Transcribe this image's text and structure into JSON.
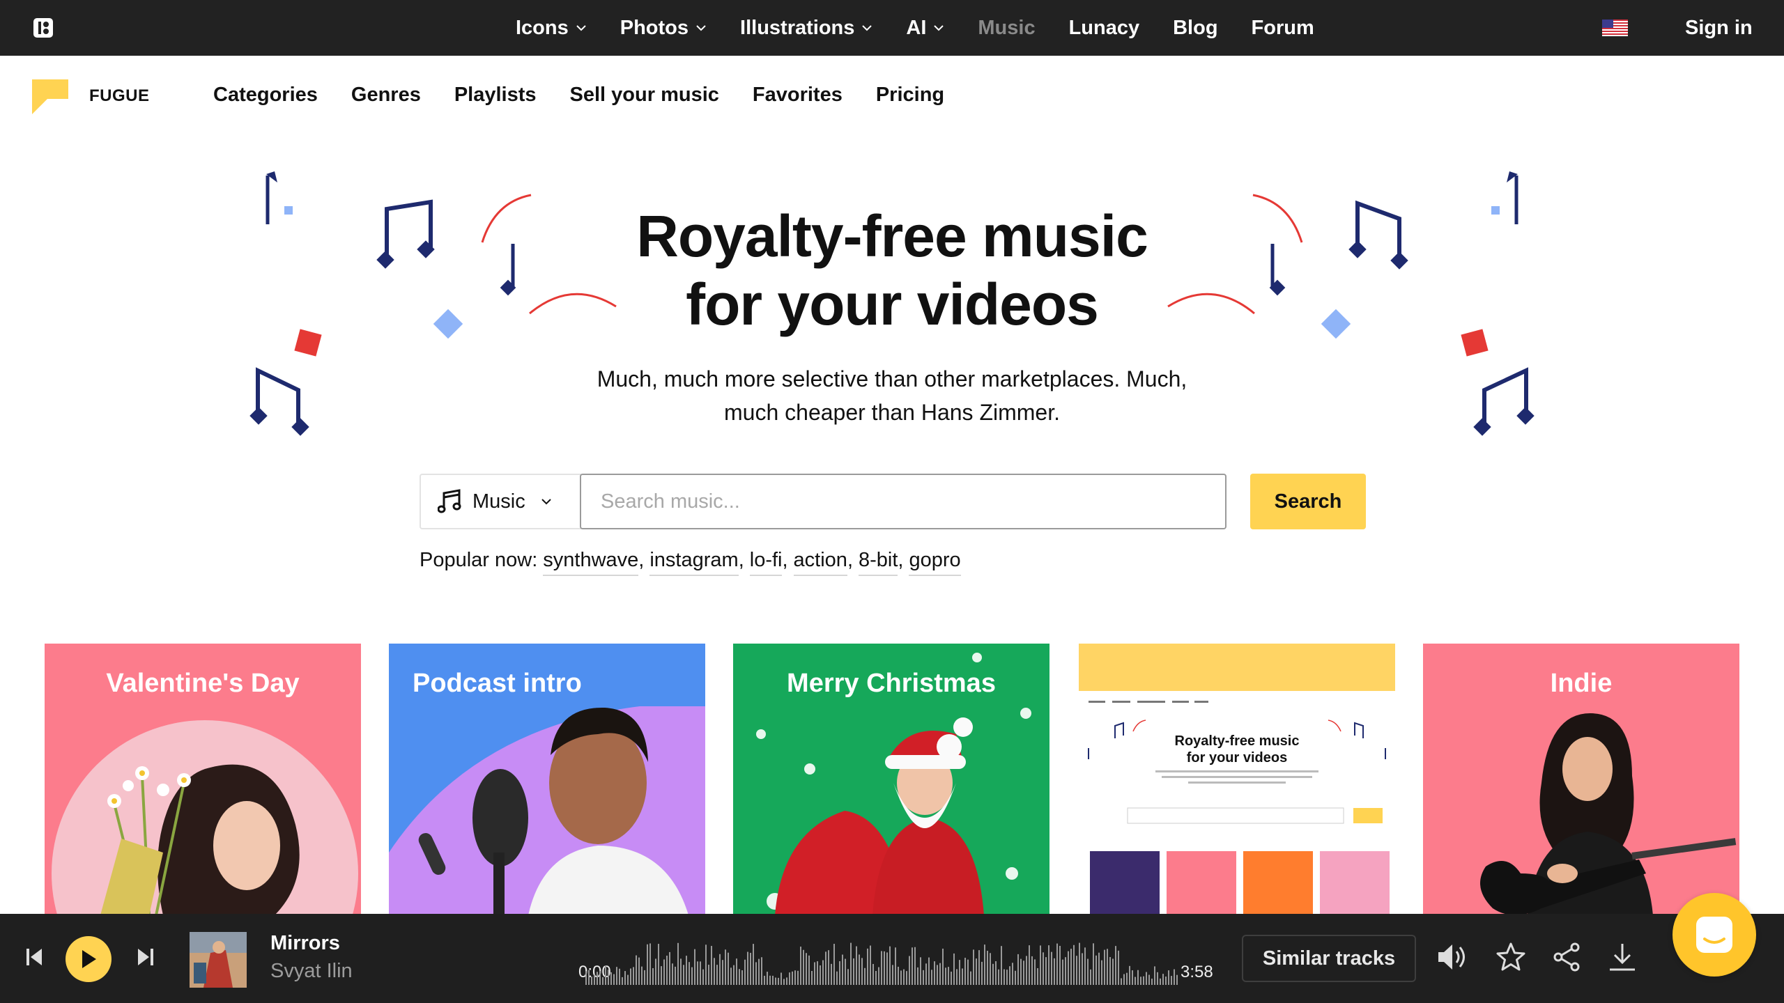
{
  "topbar": {
    "logo_icon": "icons8-logo-icon",
    "nav": [
      {
        "label": "Icons",
        "has_dropdown": true
      },
      {
        "label": "Photos",
        "has_dropdown": true
      },
      {
        "label": "Illustrations",
        "has_dropdown": true
      },
      {
        "label": "AI",
        "has_dropdown": true
      },
      {
        "label": "Music",
        "has_dropdown": false,
        "active": true
      },
      {
        "label": "Lunacy",
        "has_dropdown": false
      },
      {
        "label": "Blog",
        "has_dropdown": false
      },
      {
        "label": "Forum",
        "has_dropdown": false
      }
    ],
    "language_flag": "us-flag-icon",
    "signin_label": "Sign in"
  },
  "subnav": {
    "brand": "FUGUE",
    "links": [
      "Categories",
      "Genres",
      "Playlists",
      "Sell your music",
      "Favorites",
      "Pricing"
    ]
  },
  "hero": {
    "title_line1": "Royalty-free music",
    "title_line2": "for your videos",
    "subtitle_line1": "Much, much more selective than other marketplaces. Much,",
    "subtitle_line2": "much cheaper than Hans Zimmer."
  },
  "search": {
    "type_label": "Music",
    "placeholder": "Search music...",
    "value": "",
    "button_label": "Search",
    "popular_label": "Popular now:",
    "popular_tags": [
      "synthwave",
      "instagram",
      "lo-fi",
      "action",
      "8-bit",
      "gopro"
    ]
  },
  "cards": [
    {
      "title": "Valentine's Day",
      "bg": "#fc7c8c"
    },
    {
      "title": "Podcast intro",
      "bg": "#4f8ff0"
    },
    {
      "title": "Merry Christmas",
      "bg": "#16a85a"
    },
    {
      "title": "",
      "bg": "#ffd464",
      "mini_title_line1": "Royalty-free music",
      "mini_title_line2": "for your videos"
    },
    {
      "title": "Indie",
      "bg": "#fc7c8c"
    }
  ],
  "player": {
    "track_title": "Mirrors",
    "artist": "Svyat Ilin",
    "time_current": "0:00",
    "time_total": "3:58",
    "similar_label": "Similar tracks",
    "progress": 0
  },
  "colors": {
    "accent": "#ffd352",
    "topbar_bg": "#222222",
    "player_bg": "#1f1f1f",
    "note_navy": "#1e2a6e",
    "confetti_red": "#e53935",
    "confetti_blue": "#8fb4f8"
  }
}
